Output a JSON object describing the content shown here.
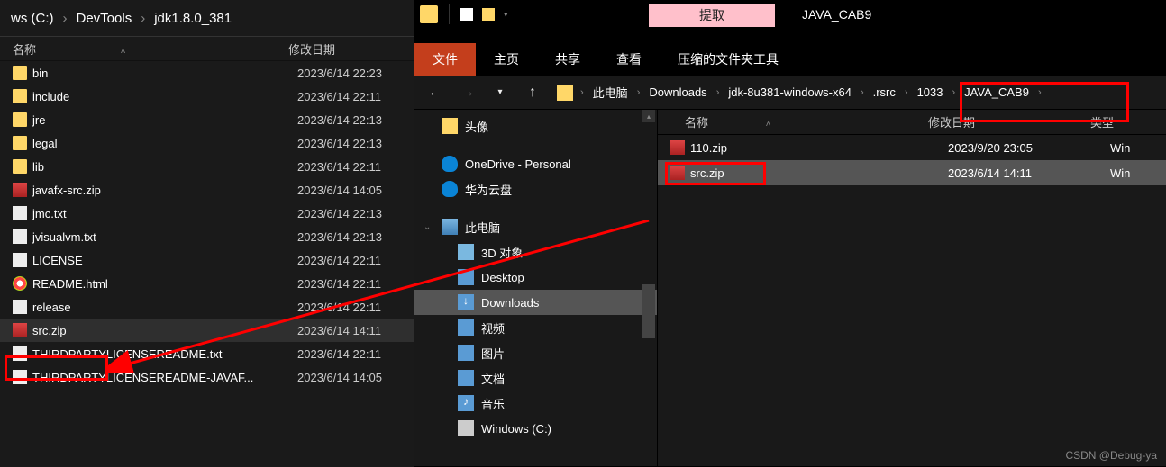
{
  "left": {
    "breadcrumb": [
      "ws (C:)",
      "DevTools",
      "jdk1.8.0_381"
    ],
    "columns": {
      "name": "名称",
      "date": "修改日期"
    },
    "files": [
      {
        "name": "bin",
        "date": "2023/6/14 22:23",
        "icon": "folder"
      },
      {
        "name": "include",
        "date": "2023/6/14 22:11",
        "icon": "folder"
      },
      {
        "name": "jre",
        "date": "2023/6/14 22:13",
        "icon": "folder"
      },
      {
        "name": "legal",
        "date": "2023/6/14 22:13",
        "icon": "folder"
      },
      {
        "name": "lib",
        "date": "2023/6/14 22:11",
        "icon": "folder"
      },
      {
        "name": "javafx-src.zip",
        "date": "2023/6/14 14:05",
        "icon": "zip"
      },
      {
        "name": "jmc.txt",
        "date": "2023/6/14 22:13",
        "icon": "txt"
      },
      {
        "name": "jvisualvm.txt",
        "date": "2023/6/14 22:13",
        "icon": "txt"
      },
      {
        "name": "LICENSE",
        "date": "2023/6/14 22:11",
        "icon": "txt"
      },
      {
        "name": "README.html",
        "date": "2023/6/14 22:11",
        "icon": "html"
      },
      {
        "name": "release",
        "date": "2023/6/14 22:11",
        "icon": "txt"
      },
      {
        "name": "src.zip",
        "date": "2023/6/14 14:11",
        "icon": "zip",
        "highlight": true
      },
      {
        "name": "THIRDPARTYLICENSEREADME.txt",
        "date": "2023/6/14 22:11",
        "icon": "txt"
      },
      {
        "name": "THIRDPARTYLICENSEREADME-JAVAF...",
        "date": "2023/6/14 14:05",
        "icon": "txt"
      }
    ]
  },
  "right": {
    "extract_label": "提取",
    "title": "JAVA_CAB9",
    "tabs": [
      {
        "label": "文件",
        "active": true
      },
      {
        "label": "主页"
      },
      {
        "label": "共享"
      },
      {
        "label": "查看"
      }
    ],
    "ribbon_tip": "压缩的文件夹工具",
    "breadcrumb": [
      "此电脑",
      "Downloads",
      "jdk-8u381-windows-x64",
      ".rsrc",
      "1033",
      "JAVA_CAB9"
    ],
    "nav_items": [
      {
        "label": "头像",
        "icon": "ni-folder"
      },
      {
        "label": "OneDrive - Personal",
        "icon": "ni-cloud",
        "gap_before": true
      },
      {
        "label": "华为云盘",
        "icon": "ni-cloud2"
      },
      {
        "label": "此电脑",
        "icon": "ni-pc",
        "gap_before": true,
        "expandable": true
      },
      {
        "label": "3D 对象",
        "icon": "ni-3d",
        "indent": true
      },
      {
        "label": "Desktop",
        "icon": "ni-desktop",
        "indent": true
      },
      {
        "label": "Downloads",
        "icon": "ni-download",
        "indent": true,
        "selected": true
      },
      {
        "label": "视频",
        "icon": "ni-video",
        "indent": true
      },
      {
        "label": "图片",
        "icon": "ni-picture",
        "indent": true
      },
      {
        "label": "文档",
        "icon": "ni-doc",
        "indent": true
      },
      {
        "label": "音乐",
        "icon": "ni-music",
        "indent": true
      },
      {
        "label": "Windows (C:)",
        "icon": "ni-drive",
        "indent": true
      }
    ],
    "columns": {
      "name": "名称",
      "date": "修改日期",
      "type": "类型"
    },
    "files": [
      {
        "name": "110.zip",
        "date": "2023/9/20 23:05",
        "type": "Win",
        "icon": "zip"
      },
      {
        "name": "src.zip",
        "date": "2023/6/14 14:11",
        "type": "Win",
        "icon": "zip",
        "selected": true
      }
    ]
  },
  "watermark": "CSDN @Debug-ya"
}
